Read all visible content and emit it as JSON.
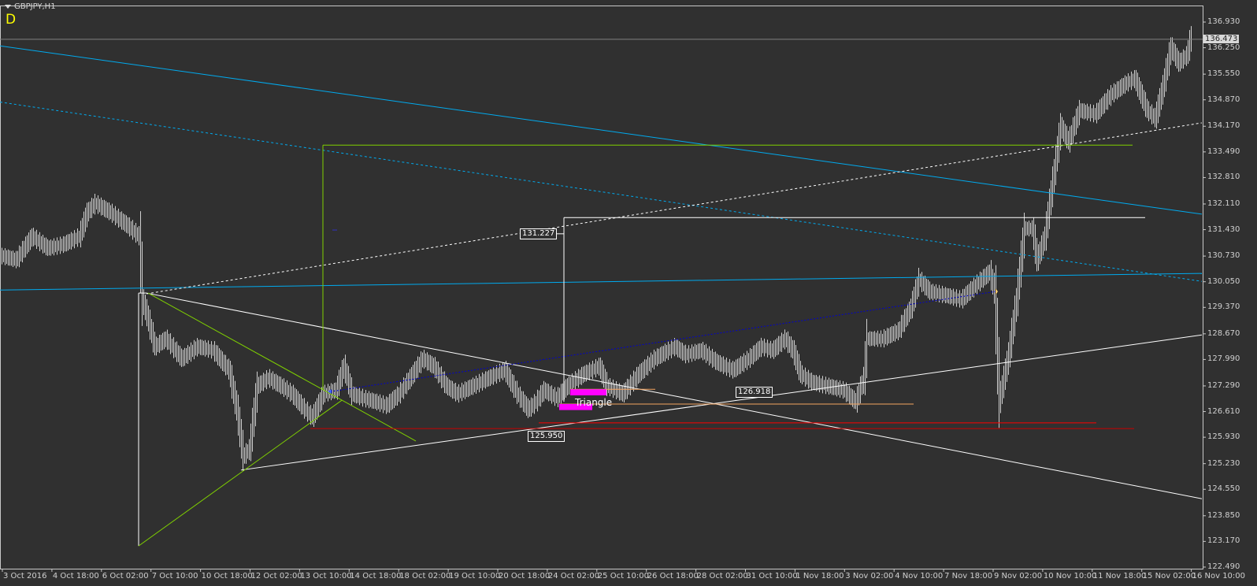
{
  "window": {
    "symbol_title": "GBPJPY,H1",
    "indicator_mark": "D"
  },
  "chart_data": {
    "type": "bar",
    "symbol": "GBPJPY",
    "timeframe": "H1",
    "ylim": [
      122.49,
      136.93
    ],
    "y_ticks": [
      "136.930",
      "136.250",
      "135.550",
      "134.870",
      "134.170",
      "133.490",
      "132.810",
      "132.110",
      "131.430",
      "130.730",
      "130.050",
      "129.370",
      "128.670",
      "127.990",
      "127.290",
      "126.610",
      "125.930",
      "125.230",
      "124.550",
      "123.850",
      "123.170",
      "122.490"
    ],
    "x_ticks": [
      "3 Oct 2016",
      "4 Oct 18:00",
      "6 Oct 02:00",
      "7 Oct 10:00",
      "10 Oct 18:00",
      "12 Oct 02:00",
      "13 Oct 10:00",
      "14 Oct 18:00",
      "18 Oct 02:00",
      "19 Oct 10:00",
      "20 Oct 18:00",
      "24 Oct 02:00",
      "25 Oct 10:00",
      "26 Oct 18:00",
      "28 Oct 02:00",
      "31 Oct 10:00",
      "1 Nov 18:00",
      "3 Nov 02:00",
      "4 Nov 10:00",
      "7 Nov 18:00",
      "9 Nov 02:00",
      "10 Nov 10:00",
      "11 Nov 18:00",
      "15 Nov 02:00",
      "16 Nov 10:00"
    ],
    "current_price": "136.473",
    "price_path": [
      [
        1,
        130.73
      ],
      [
        10,
        130.63
      ],
      [
        20,
        131.25
      ],
      [
        30,
        130.94
      ],
      [
        40,
        131.04
      ],
      [
        50,
        131.25
      ],
      [
        55,
        131.88
      ],
      [
        60,
        132.13
      ],
      [
        70,
        131.88
      ],
      [
        80,
        131.56
      ],
      [
        88,
        131.25
      ],
      [
        90,
        129.58
      ],
      [
        93,
        129.16
      ],
      [
        98,
        128.33
      ],
      [
        105,
        128.54
      ],
      [
        115,
        128.01
      ],
      [
        125,
        128.33
      ],
      [
        135,
        128.23
      ],
      [
        145,
        127.71
      ],
      [
        150,
        126.67
      ],
      [
        154,
        125.42
      ],
      [
        158,
        125.63
      ],
      [
        163,
        127.29
      ],
      [
        170,
        127.5
      ],
      [
        178,
        127.29
      ],
      [
        185,
        127.08
      ],
      [
        193,
        126.67
      ],
      [
        198,
        126.46
      ],
      [
        205,
        127.08
      ],
      [
        213,
        127.18
      ],
      [
        218,
        127.81
      ],
      [
        223,
        127.08
      ],
      [
        230,
        126.97
      ],
      [
        238,
        126.87
      ],
      [
        245,
        126.77
      ],
      [
        253,
        127.08
      ],
      [
        260,
        127.5
      ],
      [
        268,
        128.01
      ],
      [
        275,
        127.81
      ],
      [
        283,
        127.29
      ],
      [
        290,
        127.08
      ],
      [
        300,
        127.29
      ],
      [
        310,
        127.5
      ],
      [
        320,
        127.71
      ],
      [
        328,
        127.08
      ],
      [
        335,
        126.67
      ],
      [
        340,
        126.87
      ],
      [
        345,
        127.18
      ],
      [
        353,
        126.97
      ],
      [
        360,
        127.29
      ],
      [
        370,
        127.6
      ],
      [
        380,
        127.81
      ],
      [
        385,
        127.29
      ],
      [
        395,
        127.08
      ],
      [
        405,
        127.6
      ],
      [
        415,
        128.01
      ],
      [
        428,
        128.33
      ],
      [
        435,
        128.12
      ],
      [
        445,
        128.23
      ],
      [
        455,
        127.91
      ],
      [
        465,
        127.71
      ],
      [
        475,
        128.01
      ],
      [
        483,
        128.33
      ],
      [
        490,
        128.23
      ],
      [
        498,
        128.54
      ],
      [
        503,
        128.23
      ],
      [
        508,
        127.6
      ],
      [
        515,
        127.39
      ],
      [
        525,
        127.29
      ],
      [
        535,
        127.18
      ],
      [
        543,
        126.87
      ],
      [
        548,
        127.5
      ],
      [
        550,
        128.54
      ],
      [
        560,
        128.54
      ],
      [
        570,
        128.75
      ],
      [
        578,
        129.37
      ],
      [
        583,
        130.11
      ],
      [
        590,
        129.79
      ],
      [
        600,
        129.69
      ],
      [
        610,
        129.58
      ],
      [
        620,
        130.0
      ],
      [
        628,
        130.31
      ],
      [
        631,
        129.79
      ],
      [
        634,
        126.9
      ],
      [
        636,
        127.29
      ],
      [
        640,
        128.12
      ],
      [
        645,
        129.58
      ],
      [
        650,
        131.46
      ],
      [
        655,
        131.46
      ],
      [
        658,
        130.63
      ],
      [
        663,
        131.25
      ],
      [
        668,
        132.71
      ],
      [
        673,
        134.17
      ],
      [
        678,
        133.76
      ],
      [
        685,
        134.59
      ],
      [
        695,
        134.49
      ],
      [
        705,
        135.01
      ],
      [
        715,
        135.32
      ],
      [
        720,
        135.43
      ],
      [
        728,
        134.59
      ],
      [
        733,
        134.38
      ],
      [
        738,
        135.22
      ],
      [
        743,
        136.26
      ],
      [
        748,
        135.85
      ],
      [
        753,
        136.05
      ],
      [
        756,
        136.57
      ]
    ],
    "objects": [
      {
        "kind": "line",
        "color": "#00aaee",
        "dash": "",
        "from": [
          0,
          136.3
        ],
        "to": [
          763,
          131.84
        ]
      },
      {
        "kind": "line",
        "color": "#00aaee",
        "dash": "3,3",
        "from": [
          0,
          134.81
        ],
        "to": [
          763,
          130.06
        ]
      },
      {
        "kind": "line",
        "color": "#00aaee",
        "dash": "",
        "from": [
          0,
          129.83
        ],
        "to": [
          763,
          130.27
        ]
      },
      {
        "kind": "line",
        "color": "#ffffff",
        "dash": "3,3",
        "from": [
          93,
          129.73
        ],
        "to": [
          763,
          134.26
        ]
      },
      {
        "kind": "line",
        "color": "#ffffff",
        "dash": "",
        "from": [
          93,
          129.75
        ],
        "to": [
          763,
          124.3
        ]
      },
      {
        "kind": "line",
        "color": "#ffffff",
        "dash": "",
        "from": [
          153,
          125.06
        ],
        "to": [
          763,
          128.64
        ]
      },
      {
        "kind": "line",
        "color": "#ffffff",
        "dash": "",
        "from": [
          88,
          129.75
        ],
        "to": [
          88,
          123.05
        ]
      },
      {
        "kind": "line",
        "color": "#ffffff",
        "dash": "",
        "from": [
          88,
          129.75
        ],
        "to": [
          93,
          129.75
        ]
      },
      {
        "kind": "line",
        "color": "#7fd000",
        "dash": "",
        "from": [
          88,
          123.05
        ],
        "to": [
          217,
          126.91
        ]
      },
      {
        "kind": "line",
        "color": "#7fd000",
        "dash": "",
        "from": [
          94,
          129.75
        ],
        "to": [
          264,
          125.83
        ]
      },
      {
        "kind": "line",
        "color": "#7fd000",
        "dash": "",
        "from": [
          205,
          127.18
        ],
        "to": [
          205,
          133.67
        ]
      },
      {
        "kind": "line",
        "color": "#7fd000",
        "dash": "",
        "from": [
          205,
          133.67
        ],
        "to": [
          719,
          133.67
        ]
      },
      {
        "kind": "line",
        "color": "#ffffff",
        "dash": "",
        "from": [
          358,
          126.87
        ],
        "to": [
          358,
          131.75
        ]
      },
      {
        "kind": "line",
        "color": "#ffffff",
        "dash": "",
        "from": [
          358,
          131.75
        ],
        "to": [
          727,
          131.75
        ]
      },
      {
        "kind": "line",
        "color": "#ffffff",
        "dash": "",
        "from": [
          350,
          131.32
        ],
        "to": [
          358,
          131.32
        ]
      },
      {
        "kind": "line",
        "color": "#f4a460",
        "dash": "",
        "from": [
          362,
          127.2
        ],
        "to": [
          416,
          127.2
        ]
      },
      {
        "kind": "line",
        "color": "#f4a460",
        "dash": "",
        "from": [
          355,
          126.81
        ],
        "to": [
          580,
          126.81
        ]
      },
      {
        "kind": "line",
        "color": "#ff0000",
        "dash": "",
        "from": [
          342,
          126.31
        ],
        "to": [
          696,
          126.31
        ]
      },
      {
        "kind": "line",
        "color": "#cc0000",
        "dash": "",
        "from": [
          197,
          126.16
        ],
        "to": [
          720,
          126.16
        ]
      },
      {
        "kind": "line",
        "color": "#0000d0",
        "dash": "2,2",
        "from": [
          210,
          127.14
        ],
        "to": [
          632,
          129.79
        ]
      },
      {
        "kind": "line",
        "color": "#3030c0",
        "dash": "",
        "from": [
          211,
          131.42
        ],
        "to": [
          214,
          131.42
        ]
      }
    ],
    "rects": [
      {
        "color": "#ff00ff",
        "from": [
          362,
          127.2
        ],
        "to": [
          385,
          127.04
        ]
      },
      {
        "color": "#ff00ff",
        "from": [
          355,
          126.81
        ],
        "to": [
          376,
          126.65
        ]
      }
    ],
    "labels": [
      {
        "text": "131.227",
        "at": [
          330,
          131.32
        ]
      },
      {
        "text": "126.918",
        "at": [
          467,
          127.12
        ]
      },
      {
        "text": "125.950",
        "at": [
          335,
          125.96
        ]
      }
    ],
    "pattern_label": {
      "text": "Triangle",
      "at": [
        365,
        126.83
      ]
    }
  }
}
